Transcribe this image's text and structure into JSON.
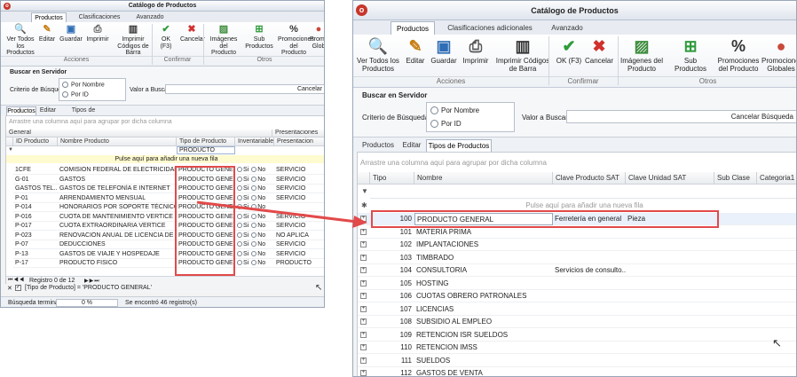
{
  "left": {
    "title": "Catálogo de Productos",
    "tabs": [
      "Productos",
      "Clasificaciones adicionales",
      "Avanzado"
    ],
    "ribbon": [
      {
        "label": "Ver Todos los Productos",
        "icon": "search-icon"
      },
      {
        "label": "Editar",
        "icon": "edit-icon"
      },
      {
        "label": "Guardar",
        "icon": "save-icon"
      },
      {
        "label": "Imprimir",
        "icon": "print-icon"
      },
      {
        "label": "Imprimir Códigos de Barra",
        "icon": "barcode-icon"
      },
      {
        "label": "OK (F3)",
        "icon": "check-icon"
      },
      {
        "label": "Cancelar",
        "icon": "cancel-icon"
      },
      {
        "label": "Imágenes del Producto",
        "icon": "image-icon"
      },
      {
        "label": "Sub Productos",
        "icon": "subproducts-icon"
      },
      {
        "label": "Promociones del Producto",
        "icon": "percent-icon"
      },
      {
        "label": "Promo Glob",
        "icon": "globe-icon"
      }
    ],
    "groups": [
      "Acciones",
      "Confirmar",
      "Otros"
    ],
    "search_title": "Buscar en Servidor",
    "criterio": "Criterio de Búsqueda",
    "opt1": "Por Nombre",
    "opt2": "Por ID",
    "valor": "Valor a Buscar",
    "cancel": "Cancelar",
    "subtabs": [
      "Productos",
      "Editar",
      "Tipos de Productos"
    ],
    "drag_hint": "Arrastre una columna aquí para agrupar por dicha columna",
    "band_general": "General",
    "band_present": "Presentaciones",
    "cols": [
      "ID Producto",
      "Nombre Producto",
      "Tipo de Producto",
      "Inventariable",
      "Presentacion"
    ],
    "filter_value": "PRODUCTO GENE...",
    "add_row": "Pulse aquí para añadir una nueva fila",
    "si": "Si",
    "no": "No",
    "rows": [
      {
        "id": "1CFE",
        "nombre": "COMISION FEDERAL DE ELECTRICIDAD",
        "tipo": "PRODUCTO GENERAL",
        "pres": "SERVICIO"
      },
      {
        "id": "G-01",
        "nombre": "GASTOS",
        "tipo": "PRODUCTO GENERAL",
        "pres": "SERVICIO"
      },
      {
        "id": "GASTOS TEL...",
        "nombre": "GASTOS DE TELEFONÍA E INTERNET",
        "tipo": "PRODUCTO GENERAL",
        "pres": "SERVICIO"
      },
      {
        "id": "P-01",
        "nombre": "ARRENDAMIENTO MENSUAL",
        "tipo": "PRODUCTO GENERAL",
        "pres": "SERVICIO"
      },
      {
        "id": "P-014",
        "nombre": "HONORARIOS POR SOPORTE TÉCNICO DE SOFT...",
        "tipo": "PRODUCTO GENERAL",
        "pres": ""
      },
      {
        "id": "P-016",
        "nombre": "CUOTA DE MANTENIMIENTO VERTICE",
        "tipo": "PRODUCTO GENERAL",
        "pres": "SERVICIO"
      },
      {
        "id": "P-017",
        "nombre": "CUOTA EXTRAORDINARIA VERTICE",
        "tipo": "PRODUCTO GENERAL",
        "pres": "SERVICIO"
      },
      {
        "id": "P-023",
        "nombre": "RENOVACIÓN ANUAL DE LICENCIA DE SOFTWARE...",
        "tipo": "PRODUCTO GENERAL",
        "pres": "NO APLICA"
      },
      {
        "id": "P-07",
        "nombre": "DEDUCCIONES",
        "tipo": "PRODUCTO GENERAL",
        "pres": "SERVICIO"
      },
      {
        "id": "P-13",
        "nombre": "GASTOS DE VIAJE Y HOSPEDAJE",
        "tipo": "PRODUCTO GENERAL",
        "pres": "SERVICIO"
      },
      {
        "id": "P-17",
        "nombre": "PRODUCTO FISICO",
        "tipo": "PRODUCTO GENERAL",
        "pres": "PRODUCTO"
      }
    ],
    "nav_text": "Registro 0 de 12",
    "filter_text": "[Tipo de Producto] = 'PRODUCTO GENERAL'",
    "status1": "Búsqueda terminada",
    "status_pct": "0 %",
    "status2": "Se encontró 46 registro(s)"
  },
  "right": {
    "title": "Catálogo de Productos",
    "tabs": [
      "Productos",
      "Clasificaciones adicionales",
      "Avanzado"
    ],
    "ribbon": [
      {
        "label": "Ver Todos los Productos",
        "icon": "search-icon"
      },
      {
        "label": "Editar",
        "icon": "edit-icon"
      },
      {
        "label": "Guardar",
        "icon": "save-icon"
      },
      {
        "label": "Imprimir",
        "icon": "print-icon"
      },
      {
        "label": "Imprimir Códigos de Barra",
        "icon": "barcode-icon"
      },
      {
        "label": "OK (F3)",
        "icon": "check-icon"
      },
      {
        "label": "Cancelar",
        "icon": "cancel-icon"
      },
      {
        "label": "Imágenes del Producto",
        "icon": "image-icon"
      },
      {
        "label": "Sub Productos",
        "icon": "subproducts-icon"
      },
      {
        "label": "Promociones del Producto",
        "icon": "percent-icon"
      },
      {
        "label": "Promociones Globales",
        "icon": "globe-icon"
      }
    ],
    "groups": [
      "Acciones",
      "Confirmar",
      "Otros"
    ],
    "search_title": "Buscar en Servidor",
    "criterio": "Criterio de Búsqueda",
    "opt1": "Por Nombre",
    "opt2": "Por ID",
    "valor": "Valor a Buscar",
    "cancel": "Cancelar Búsqueda",
    "subtabs": [
      "Productos",
      "Editar",
      "Tipos de Productos"
    ],
    "drag_hint": "Arrastre una columna aquí para agrupar por dicha columna",
    "cols": [
      "Tipo",
      "Nombre",
      "Clave Producto SAT",
      "Clave Unidad SAT",
      "Sub Clase",
      "Categoria1"
    ],
    "add_row": "Pulse aquí para añadir una nueva fila",
    "rows": [
      {
        "tipo": "100",
        "nombre": "PRODUCTO GENERAL",
        "sat": "Ferretería en general",
        "unidad": "Pieza"
      },
      {
        "tipo": "101",
        "nombre": "MATERIA PRIMA",
        "sat": "",
        "unidad": ""
      },
      {
        "tipo": "102",
        "nombre": "IMPLANTACIONES",
        "sat": "",
        "unidad": ""
      },
      {
        "tipo": "103",
        "nombre": "TIMBRADO",
        "sat": "",
        "unidad": ""
      },
      {
        "tipo": "104",
        "nombre": "CONSULTORIA",
        "sat": "Servicios de consulto...",
        "unidad": ""
      },
      {
        "tipo": "105",
        "nombre": "HOSTING",
        "sat": "",
        "unidad": ""
      },
      {
        "tipo": "106",
        "nombre": "CUOTAS OBRERO PATRONALES",
        "sat": "",
        "unidad": ""
      },
      {
        "tipo": "107",
        "nombre": "LICENCIAS",
        "sat": "",
        "unidad": ""
      },
      {
        "tipo": "108",
        "nombre": "SUBSIDIO AL EMPLEO",
        "sat": "",
        "unidad": ""
      },
      {
        "tipo": "109",
        "nombre": "RETENCION ISR SUELDOS",
        "sat": "",
        "unidad": ""
      },
      {
        "tipo": "110",
        "nombre": "RETENCION IMSS",
        "sat": "",
        "unidad": ""
      },
      {
        "tipo": "111",
        "nombre": "SUELDOS",
        "sat": "",
        "unidad": ""
      },
      {
        "tipo": "112",
        "nombre": "GASTOS DE VENTA",
        "sat": "",
        "unidad": ""
      }
    ]
  },
  "colors": {
    "highlight": "#e24a4a",
    "accent": "#2f6db5"
  }
}
